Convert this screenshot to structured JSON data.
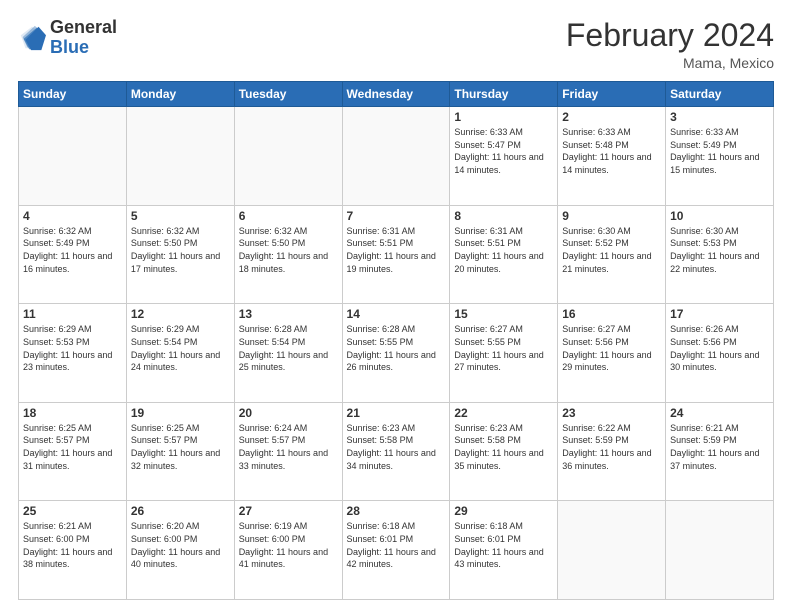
{
  "logo": {
    "general": "General",
    "blue": "Blue"
  },
  "header": {
    "month": "February 2024",
    "location": "Mama, Mexico"
  },
  "days_of_week": [
    "Sunday",
    "Monday",
    "Tuesday",
    "Wednesday",
    "Thursday",
    "Friday",
    "Saturday"
  ],
  "weeks": [
    [
      {
        "day": "",
        "info": ""
      },
      {
        "day": "",
        "info": ""
      },
      {
        "day": "",
        "info": ""
      },
      {
        "day": "",
        "info": ""
      },
      {
        "day": "1",
        "info": "Sunrise: 6:33 AM\nSunset: 5:47 PM\nDaylight: 11 hours and 14 minutes."
      },
      {
        "day": "2",
        "info": "Sunrise: 6:33 AM\nSunset: 5:48 PM\nDaylight: 11 hours and 14 minutes."
      },
      {
        "day": "3",
        "info": "Sunrise: 6:33 AM\nSunset: 5:49 PM\nDaylight: 11 hours and 15 minutes."
      }
    ],
    [
      {
        "day": "4",
        "info": "Sunrise: 6:32 AM\nSunset: 5:49 PM\nDaylight: 11 hours and 16 minutes."
      },
      {
        "day": "5",
        "info": "Sunrise: 6:32 AM\nSunset: 5:50 PM\nDaylight: 11 hours and 17 minutes."
      },
      {
        "day": "6",
        "info": "Sunrise: 6:32 AM\nSunset: 5:50 PM\nDaylight: 11 hours and 18 minutes."
      },
      {
        "day": "7",
        "info": "Sunrise: 6:31 AM\nSunset: 5:51 PM\nDaylight: 11 hours and 19 minutes."
      },
      {
        "day": "8",
        "info": "Sunrise: 6:31 AM\nSunset: 5:51 PM\nDaylight: 11 hours and 20 minutes."
      },
      {
        "day": "9",
        "info": "Sunrise: 6:30 AM\nSunset: 5:52 PM\nDaylight: 11 hours and 21 minutes."
      },
      {
        "day": "10",
        "info": "Sunrise: 6:30 AM\nSunset: 5:53 PM\nDaylight: 11 hours and 22 minutes."
      }
    ],
    [
      {
        "day": "11",
        "info": "Sunrise: 6:29 AM\nSunset: 5:53 PM\nDaylight: 11 hours and 23 minutes."
      },
      {
        "day": "12",
        "info": "Sunrise: 6:29 AM\nSunset: 5:54 PM\nDaylight: 11 hours and 24 minutes."
      },
      {
        "day": "13",
        "info": "Sunrise: 6:28 AM\nSunset: 5:54 PM\nDaylight: 11 hours and 25 minutes."
      },
      {
        "day": "14",
        "info": "Sunrise: 6:28 AM\nSunset: 5:55 PM\nDaylight: 11 hours and 26 minutes."
      },
      {
        "day": "15",
        "info": "Sunrise: 6:27 AM\nSunset: 5:55 PM\nDaylight: 11 hours and 27 minutes."
      },
      {
        "day": "16",
        "info": "Sunrise: 6:27 AM\nSunset: 5:56 PM\nDaylight: 11 hours and 29 minutes."
      },
      {
        "day": "17",
        "info": "Sunrise: 6:26 AM\nSunset: 5:56 PM\nDaylight: 11 hours and 30 minutes."
      }
    ],
    [
      {
        "day": "18",
        "info": "Sunrise: 6:25 AM\nSunset: 5:57 PM\nDaylight: 11 hours and 31 minutes."
      },
      {
        "day": "19",
        "info": "Sunrise: 6:25 AM\nSunset: 5:57 PM\nDaylight: 11 hours and 32 minutes."
      },
      {
        "day": "20",
        "info": "Sunrise: 6:24 AM\nSunset: 5:57 PM\nDaylight: 11 hours and 33 minutes."
      },
      {
        "day": "21",
        "info": "Sunrise: 6:23 AM\nSunset: 5:58 PM\nDaylight: 11 hours and 34 minutes."
      },
      {
        "day": "22",
        "info": "Sunrise: 6:23 AM\nSunset: 5:58 PM\nDaylight: 11 hours and 35 minutes."
      },
      {
        "day": "23",
        "info": "Sunrise: 6:22 AM\nSunset: 5:59 PM\nDaylight: 11 hours and 36 minutes."
      },
      {
        "day": "24",
        "info": "Sunrise: 6:21 AM\nSunset: 5:59 PM\nDaylight: 11 hours and 37 minutes."
      }
    ],
    [
      {
        "day": "25",
        "info": "Sunrise: 6:21 AM\nSunset: 6:00 PM\nDaylight: 11 hours and 38 minutes."
      },
      {
        "day": "26",
        "info": "Sunrise: 6:20 AM\nSunset: 6:00 PM\nDaylight: 11 hours and 40 minutes."
      },
      {
        "day": "27",
        "info": "Sunrise: 6:19 AM\nSunset: 6:00 PM\nDaylight: 11 hours and 41 minutes."
      },
      {
        "day": "28",
        "info": "Sunrise: 6:18 AM\nSunset: 6:01 PM\nDaylight: 11 hours and 42 minutes."
      },
      {
        "day": "29",
        "info": "Sunrise: 6:18 AM\nSunset: 6:01 PM\nDaylight: 11 hours and 43 minutes."
      },
      {
        "day": "",
        "info": ""
      },
      {
        "day": "",
        "info": ""
      }
    ]
  ]
}
